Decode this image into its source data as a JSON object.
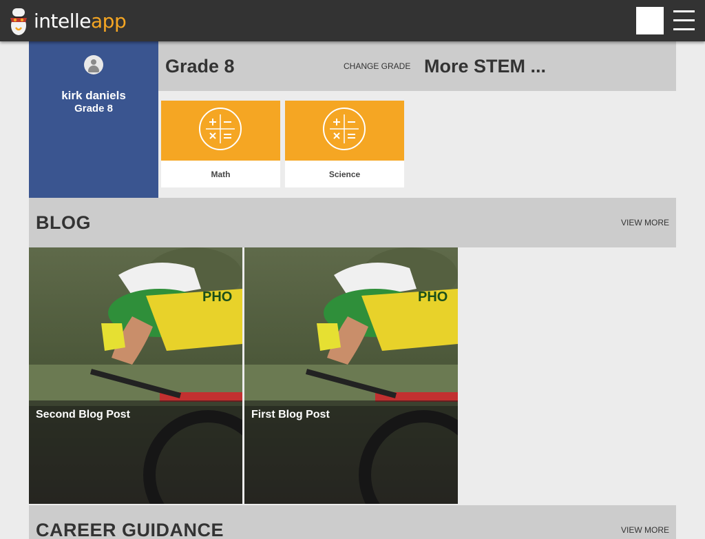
{
  "header": {
    "logo_part1": "intelle",
    "logo_part2": "app",
    "menu_icon": "hamburger-menu-icon",
    "accent": "#f5a623",
    "bar_color": "#333333"
  },
  "profile": {
    "avatar_icon": "user-avatar-icon",
    "name": "kirk daniels",
    "grade": "Grade 8",
    "bg_color": "#3a5590"
  },
  "grade_header": {
    "title": "Grade 8",
    "change_label": "CHANGE GRADE",
    "stem_title": "More STEM ..."
  },
  "subjects": [
    {
      "label": "Math",
      "icon": "math-operators-icon"
    },
    {
      "label": "Science",
      "icon": "math-operators-icon"
    }
  ],
  "blog": {
    "title": "BLOG",
    "view_more": "VIEW MORE",
    "posts": [
      {
        "title": "Second Blog Post",
        "image": "cyclist-photo"
      },
      {
        "title": "First Blog Post",
        "image": "cyclist-photo"
      }
    ]
  },
  "career": {
    "title": "CAREER GUIDANCE",
    "view_more": "VIEW MORE"
  }
}
